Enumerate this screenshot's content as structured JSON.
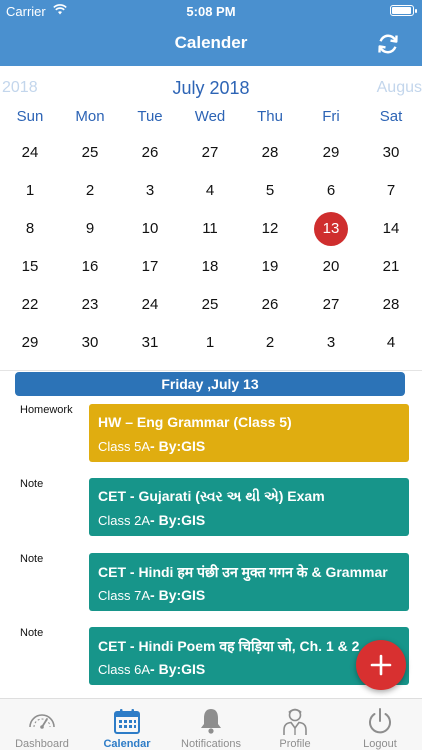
{
  "status_bar": {
    "carrier": "Carrier",
    "time": "5:08 PM",
    "battery_level": 1.0
  },
  "header": {
    "title": "Calender",
    "refresh_icon": "refresh-icon"
  },
  "calendar": {
    "prev_month": "2018",
    "current_month": "July 2018",
    "next_month": "Augus",
    "weekdays": [
      "Sun",
      "Mon",
      "Tue",
      "Wed",
      "Thu",
      "Fri",
      "Sat"
    ],
    "weeks": [
      [
        "24",
        "25",
        "26",
        "27",
        "28",
        "29",
        "30"
      ],
      [
        "1",
        "2",
        "3",
        "4",
        "5",
        "6",
        "7"
      ],
      [
        "8",
        "9",
        "10",
        "11",
        "12",
        "13",
        "14"
      ],
      [
        "15",
        "16",
        "17",
        "18",
        "19",
        "20",
        "21"
      ],
      [
        "22",
        "23",
        "24",
        "25",
        "26",
        "27",
        "28"
      ],
      [
        "29",
        "30",
        "31",
        "1",
        "2",
        "3",
        "4"
      ]
    ],
    "selected_day": "13",
    "selected_color": "#cf2e2e",
    "accent_color": "#2d64b5"
  },
  "selected_date_label": "Friday ,July 13",
  "events": [
    {
      "type": "Homework",
      "title": "HW – Eng Grammar (Class 5)",
      "class_label": "Class 5A",
      "by": "- By:GIS",
      "color": "#e0ad10"
    },
    {
      "type": "Note",
      "title": "CET - Gujarati (સ્વર અ થી એ) Exam",
      "class_label": "Class 2A",
      "by": "- By:GIS",
      "color": "#17958a"
    },
    {
      "type": "Note",
      "title": "CET - Hindi हम पंछी उन मुक्त गगन के & Grammar",
      "class_label": "Class 7A",
      "by": "- By:GIS",
      "color": "#17958a"
    },
    {
      "type": "Note",
      "title": "CET - Hindi Poem वह चिड़िया जो, Ch. 1 & 2",
      "class_label": "Class 6A",
      "by": "- By:GIS",
      "color": "#17958a"
    }
  ],
  "fab": {
    "icon": "plus-icon",
    "color": "#d83030"
  },
  "tabs": [
    {
      "label": "Dashboard",
      "icon": "gauge-icon"
    },
    {
      "label": "Calendar",
      "icon": "calendar-icon",
      "active": true
    },
    {
      "label": "Notifications",
      "icon": "bell-icon"
    },
    {
      "label": "Profile",
      "icon": "person-icon"
    },
    {
      "label": "Logout",
      "icon": "power-icon"
    }
  ]
}
